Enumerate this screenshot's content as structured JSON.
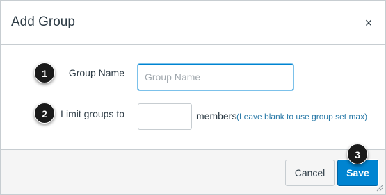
{
  "dialog": {
    "title": "Add Group",
    "close_label": "×"
  },
  "form": {
    "group_name_label": "Group Name",
    "group_name_placeholder": "Group Name",
    "group_name_value": "",
    "limit_label": "Limit groups to",
    "limit_value": "",
    "members_label": "members",
    "limit_hint": "(Leave blank to use group set max)"
  },
  "footer": {
    "cancel_label": "Cancel",
    "save_label": "Save"
  },
  "annotations": [
    "1",
    "2",
    "3"
  ],
  "colors": {
    "primary": "#0084d1",
    "text": "#2d3b45",
    "hint": "#2a7aa8",
    "footer_bg": "#f5f5f5",
    "border": "#c7cdd1"
  }
}
